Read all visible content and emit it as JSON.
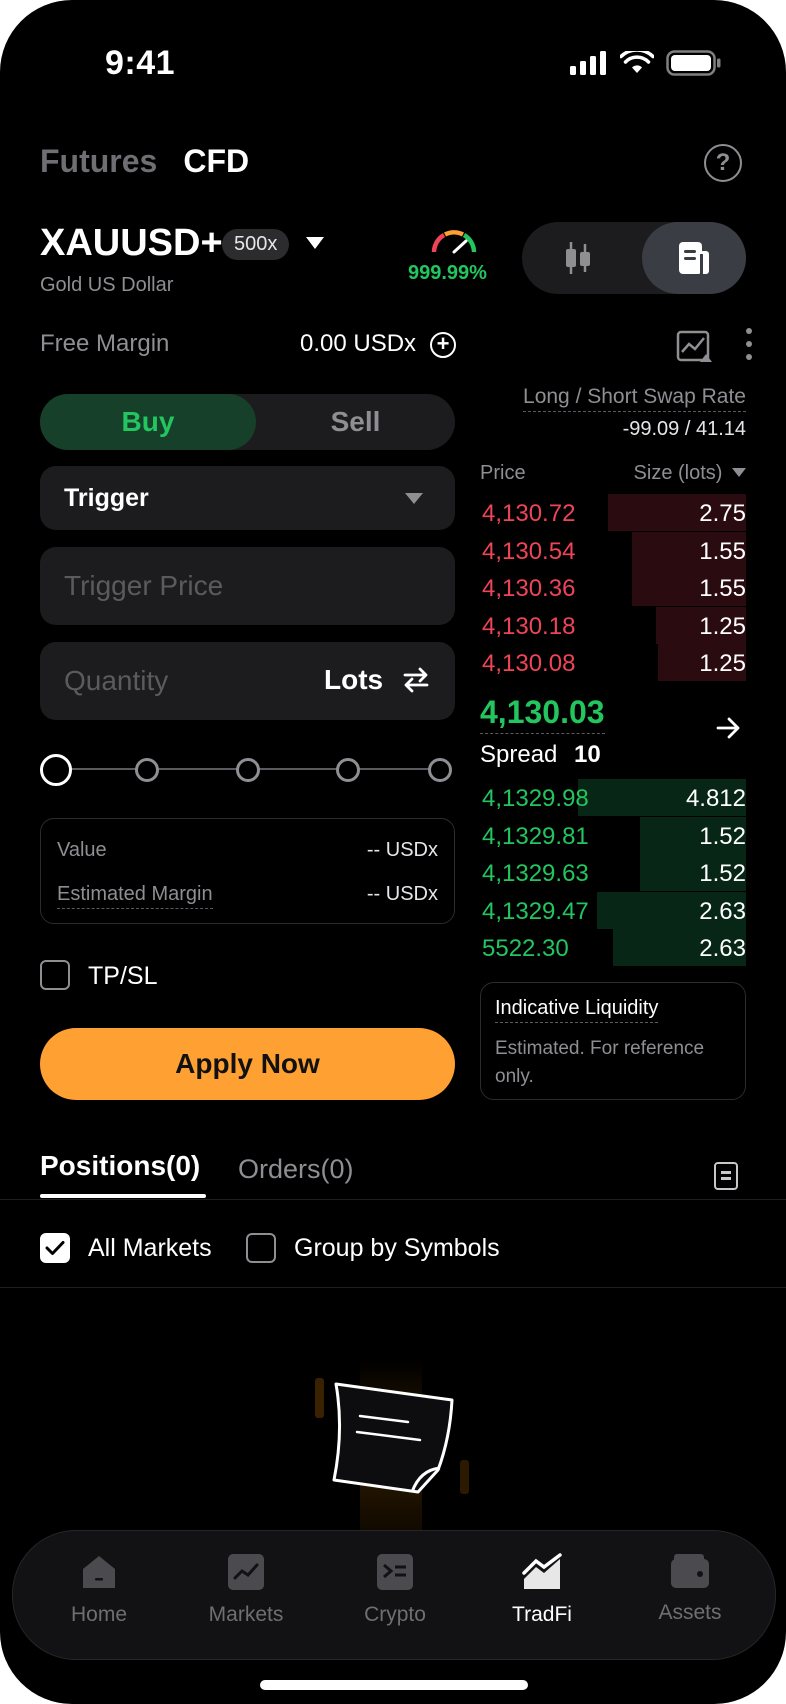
{
  "status": {
    "time": "9:41"
  },
  "top_tabs": {
    "futures": "Futures",
    "cfd": "CFD"
  },
  "help": {
    "glyph": "?"
  },
  "symbol": {
    "name": "XAUUSD+",
    "leverage": "500x",
    "description": "Gold US Dollar",
    "gauge_percent": "999.99%"
  },
  "account": {
    "free_margin_label": "Free Margin",
    "free_margin_value": "0.00 USDx",
    "add_glyph": "+"
  },
  "order_form": {
    "buy_label": "Buy",
    "sell_label": "Sell",
    "order_type": "Trigger",
    "trigger_price_placeholder": "Trigger Price",
    "quantity_placeholder": "Quantity",
    "quantity_unit": "Lots",
    "slider_percent": 0,
    "value_label": "Value",
    "value_amount": "-- USDx",
    "est_margin_label": "Estimated Margin",
    "est_margin_amount": "-- USDx",
    "tpsl_label": "TP/SL",
    "tpsl_checked": false,
    "apply_label": "Apply Now"
  },
  "order_book": {
    "swap_rate_label": "Long / Short Swap Rate",
    "swap_rate_value": "-99.09 / 41.14",
    "price_header": "Price",
    "size_header": "Size (lots)",
    "asks": [
      {
        "price": "4,130.72",
        "size": "2.75",
        "depth": 0.52
      },
      {
        "price": "4,130.54",
        "size": "1.55",
        "depth": 0.43
      },
      {
        "price": "4,130.36",
        "size": "1.55",
        "depth": 0.43
      },
      {
        "price": "4,130.18",
        "size": "1.25",
        "depth": 0.34
      },
      {
        "price": "4,130.08",
        "size": "1.25",
        "depth": 0.33
      }
    ],
    "mid_price": "4,130.03",
    "spread_label": "Spread",
    "spread_value": "10",
    "bids": [
      {
        "price": "4,1329.98",
        "size": "4.812",
        "depth": 0.63
      },
      {
        "price": "4,1329.81",
        "size": "1.52",
        "depth": 0.4
      },
      {
        "price": "4,1329.63",
        "size": "1.52",
        "depth": 0.4
      },
      {
        "price": "4,1329.47",
        "size": "2.63",
        "depth": 0.56
      },
      {
        "price": "5522.30",
        "size": "2.63",
        "depth": 0.5
      }
    ],
    "liquidity_title": "Indicative Liquidity",
    "liquidity_desc": "Estimated. For reference only."
  },
  "positions": {
    "positions_tab": "Positions(0)",
    "orders_tab": "Orders(0)",
    "all_markets_label": "All Markets",
    "all_markets_checked": true,
    "group_label": "Group by Symbols",
    "group_checked": false
  },
  "nav": {
    "items": [
      {
        "label": "Home",
        "icon": "home-icon"
      },
      {
        "label": "Markets",
        "icon": "markets-icon"
      },
      {
        "label": "Crypto",
        "icon": "crypto-icon"
      },
      {
        "label": "TradFi",
        "icon": "tradfi-icon"
      },
      {
        "label": "Assets",
        "icon": "wallet-icon"
      }
    ],
    "active": "TradFi"
  },
  "colors": {
    "background": "#000000",
    "buy_green": "#22c55e",
    "sell_red": "#ef4458",
    "accent_orange": "#ffa033",
    "surface": "#1c1c1e"
  }
}
